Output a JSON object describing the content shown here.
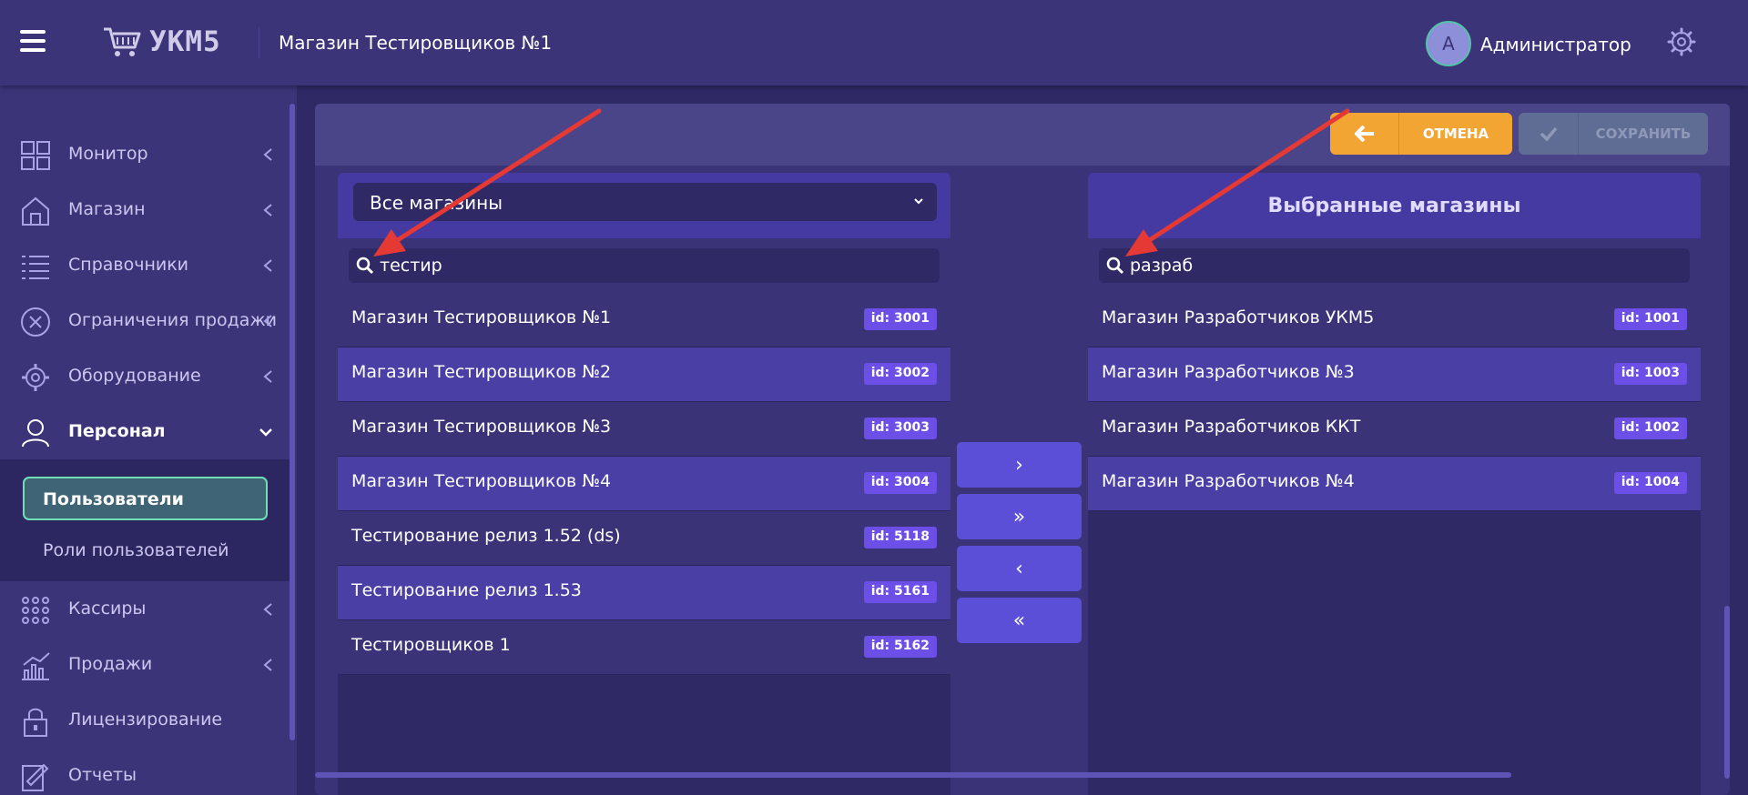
{
  "header": {
    "logo_text": "УКМ5",
    "store_title": "Магазин Тестировщиков №1",
    "avatar_letter": "А",
    "user_name": "Администратор"
  },
  "sidebar": {
    "items": [
      {
        "label": "Монитор",
        "icon": "dashboard-icon"
      },
      {
        "label": "Магазин",
        "icon": "store-icon"
      },
      {
        "label": "Справочники",
        "icon": "list-icon"
      },
      {
        "label": "Ограничения продажи",
        "icon": "cancel-circle-icon"
      },
      {
        "label": "Оборудование",
        "icon": "gear-icon"
      },
      {
        "label": "Персонал",
        "icon": "person-icon"
      },
      {
        "label": "Кассиры",
        "icon": "dots-grid-icon"
      },
      {
        "label": "Продажи",
        "icon": "chart-icon"
      },
      {
        "label": "Лицензирование",
        "icon": "lock-icon"
      },
      {
        "label": "Отчеты",
        "icon": "report-icon"
      }
    ],
    "submenu": {
      "active": "Пользователи",
      "other": "Роли пользователей"
    }
  },
  "toolbar": {
    "cancel_label": "ОТМЕНА",
    "save_label": "СОХРАНИТЬ"
  },
  "left_panel": {
    "select_value": "Все магазины",
    "search_value": "тестир",
    "rows": [
      {
        "name": "Магазин Тестировщиков №1",
        "id": "id: 3001"
      },
      {
        "name": "Магазин Тестировщиков №2",
        "id": "id: 3002"
      },
      {
        "name": "Магазин Тестировщиков №3",
        "id": "id: 3003"
      },
      {
        "name": "Магазин Тестировщиков №4",
        "id": "id: 3004"
      },
      {
        "name": "Тестирование релиз 1.52 (ds)",
        "id": "id: 5118"
      },
      {
        "name": "Тестирование релиз 1.53",
        "id": "id: 5161"
      },
      {
        "name": "Тестировщиков 1",
        "id": "id: 5162"
      }
    ]
  },
  "right_panel": {
    "title": "Выбранные магазины",
    "search_value": "разраб",
    "rows": [
      {
        "name": "Магазин Разработчиков УКМ5",
        "id": "id: 1001"
      },
      {
        "name": "Магазин Разработчиков №3",
        "id": "id: 1003"
      },
      {
        "name": "Магазин Разработчиков ККТ",
        "id": "id: 1002"
      },
      {
        "name": "Магазин Разработчиков №4",
        "id": "id: 1004"
      }
    ]
  },
  "transfer_buttons": [
    "›",
    "»",
    "‹",
    "«"
  ],
  "colors": {
    "background": "#2f2a66",
    "header": "#3b3478",
    "accent": "#5b4fd8",
    "cancel": "#f3a534",
    "save_disabled": "#5f6d94",
    "active_border": "#6ee0b4",
    "arrow": "#e53935"
  }
}
